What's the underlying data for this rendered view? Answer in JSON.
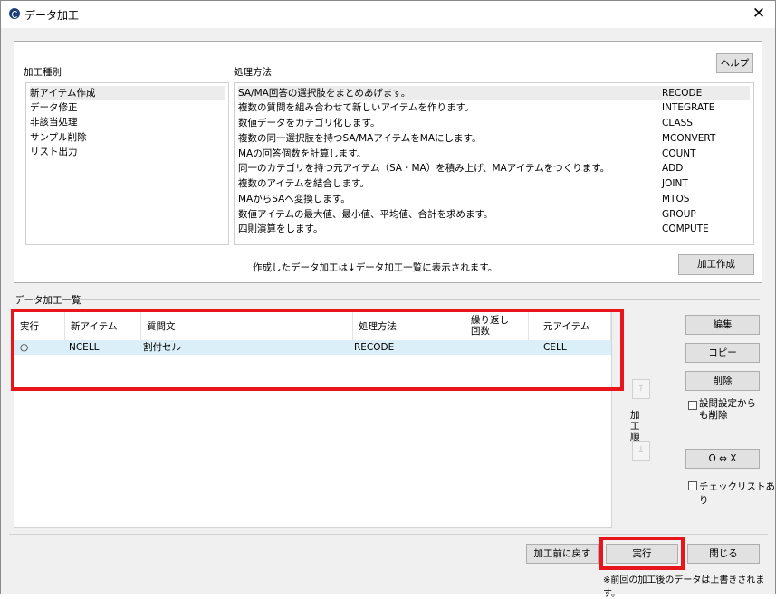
{
  "window": {
    "title": "データ加工",
    "close_glyph": "✕"
  },
  "top": {
    "type_label": "加工種別",
    "method_label": "処理方法",
    "help_button": "ヘルプ",
    "types": [
      "新アイテム作成",
      "データ修正",
      "非該当処理",
      "サンプル削除",
      "リスト出力"
    ],
    "methods": [
      {
        "desc": "SA/MA回答の選択肢をまとめあげます。",
        "name": "RECODE"
      },
      {
        "desc": "複数の質問を組み合わせて新しいアイテムを作ります。",
        "name": "INTEGRATE"
      },
      {
        "desc": "数値データをカテゴリ化します。",
        "name": "CLASS"
      },
      {
        "desc": "複数の同一選択肢を持つSA/MAアイテムをMAにします。",
        "name": "MCONVERT"
      },
      {
        "desc": "MAの回答個数を計算します。",
        "name": "COUNT"
      },
      {
        "desc": "同一のカテゴリを持つ元アイテム（SA・MA）を積み上げ、MAアイテムをつくります。",
        "name": "ADD"
      },
      {
        "desc": "複数のアイテムを結合します。",
        "name": "JOINT"
      },
      {
        "desc": "MAからSAへ変換します。",
        "name": "MTOS"
      },
      {
        "desc": "数値アイテムの最大値、最小値、平均値、合計を求めます。",
        "name": "GROUP"
      },
      {
        "desc": "四則演算をします。",
        "name": "COMPUTE"
      }
    ],
    "info_text": "作成したデータ加工は↓データ加工一覧に表示されます。",
    "create_button": "加工作成"
  },
  "list": {
    "group_label": "データ加工一覧",
    "columns": [
      "実行",
      "新アイテム",
      "質問文",
      "処理方法",
      "繰り返し回数",
      "元アイテム"
    ],
    "rows": [
      {
        "run": "○",
        "new_item": "NCELL",
        "question": "割付セル",
        "method": "RECODE",
        "repeat": "",
        "source": "CELL"
      }
    ]
  },
  "side": {
    "edit_button": "編集",
    "copy_button": "コピー",
    "delete_button": "削除",
    "delete_setting_label": "設問設定からも削除",
    "order_label": "加工順",
    "up_glyph": "↑",
    "down_glyph": "↓",
    "ox_button": "O ⇔ X",
    "checklist_label": "チェックリストあり"
  },
  "footer": {
    "revert_button": "加工前に戻す",
    "run_button": "実行",
    "close_button": "閉じる",
    "note": "※前回の加工後のデータは上書きされます。"
  },
  "colors": {
    "highlight": "#e8161a",
    "row_selected": "#dbeff8",
    "button_bg": "#e1e1e1"
  }
}
